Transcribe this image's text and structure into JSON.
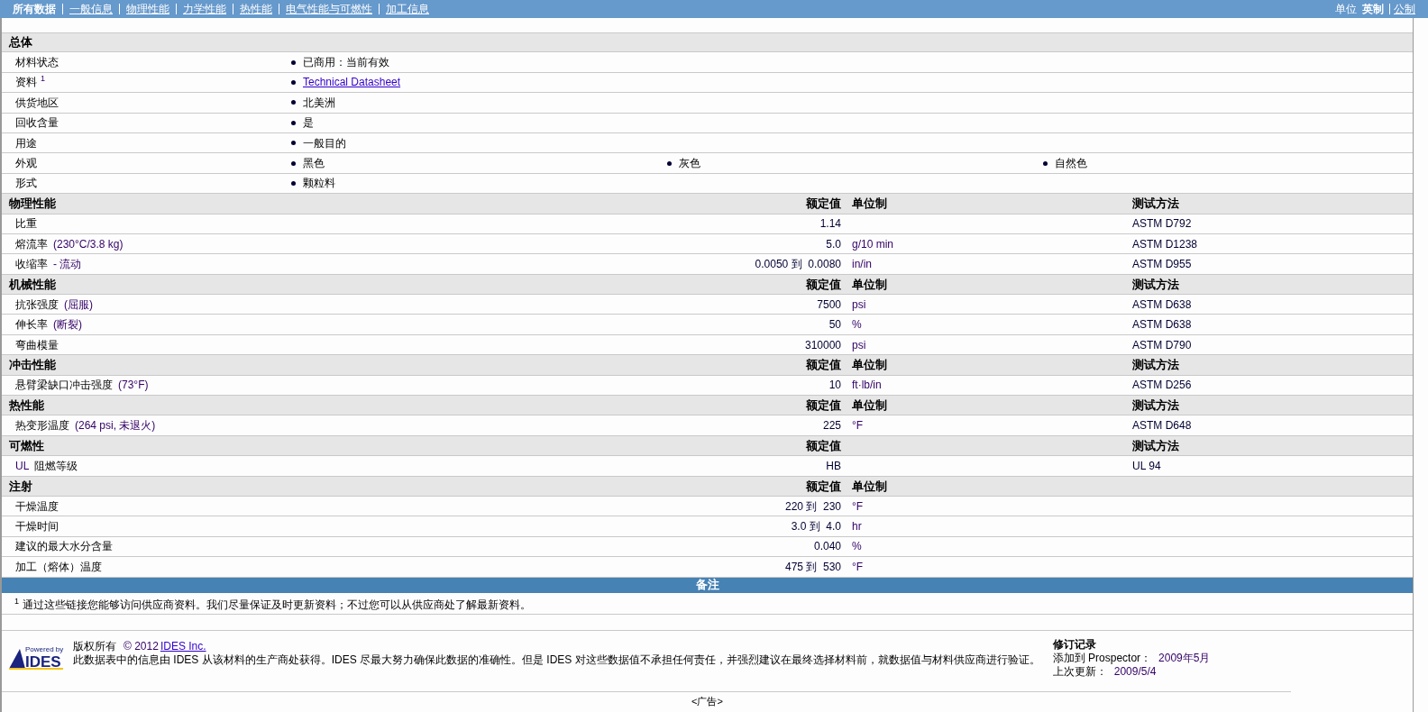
{
  "nav": {
    "tabs": [
      {
        "label": "所有数据",
        "selected": true
      },
      {
        "label": "一般信息",
        "selected": false
      },
      {
        "label": "物理性能",
        "selected": false
      },
      {
        "label": "力学性能",
        "selected": false
      },
      {
        "label": "热性能",
        "selected": false
      },
      {
        "label": "电气性能与可燃性",
        "selected": false
      },
      {
        "label": "加工信息",
        "selected": false
      }
    ],
    "units_label": "单位",
    "units": [
      {
        "label": "英制",
        "selected": true
      },
      {
        "label": "公制",
        "selected": false
      }
    ]
  },
  "sections": [
    {
      "kind": "general",
      "title": "总体",
      "rows": [
        {
          "label": "材料状态",
          "values": [
            {
              "kind": "text",
              "text": "已商用：当前有效"
            }
          ]
        },
        {
          "label": "资料",
          "sup": "1",
          "values": [
            {
              "kind": "link",
              "text": "Technical Datasheet"
            }
          ]
        },
        {
          "label": "供货地区",
          "values": [
            {
              "kind": "text",
              "text": "北美洲"
            }
          ]
        },
        {
          "label": "回收含量",
          "values": [
            {
              "kind": "text",
              "text": "是"
            }
          ]
        },
        {
          "label": "用途",
          "values": [
            {
              "kind": "text",
              "text": "一般目的"
            }
          ]
        },
        {
          "label": "外观",
          "values": [
            {
              "kind": "text",
              "text": "黑色"
            },
            {
              "kind": "text",
              "text": "灰色"
            },
            {
              "kind": "text",
              "text": "自然色"
            }
          ]
        },
        {
          "label": "形式",
          "values": [
            {
              "kind": "text",
              "text": "颗粒料"
            }
          ]
        }
      ]
    },
    {
      "kind": "property",
      "title": "物理性能",
      "headers": {
        "value": "额定值",
        "unit": "单位制",
        "method": "测试方法"
      },
      "rows": [
        {
          "label": "比重",
          "value": "1.14",
          "method": "ASTM D792"
        },
        {
          "label": "熔流率",
          "condition": "(230°C/3.8 kg)",
          "value": "5.0",
          "unit": "g/10 min",
          "method": "ASTM D1238"
        },
        {
          "label": "收缩率",
          "condition": "- 流动",
          "value": "0.0050 到  0.0080",
          "unit": "in/in",
          "method": "ASTM D955"
        }
      ]
    },
    {
      "kind": "property",
      "title": "机械性能",
      "headers": {
        "value": "额定值",
        "unit": "单位制",
        "method": "测试方法"
      },
      "rows": [
        {
          "label": "抗张强度",
          "condition": "(屈服)",
          "value": "7500",
          "unit": "psi",
          "method": "ASTM D638"
        },
        {
          "label": "伸长率",
          "condition": "(断裂)",
          "value": "50",
          "unit": "%",
          "method": "ASTM D638"
        },
        {
          "label": "弯曲模量",
          "value": "310000",
          "unit": "psi",
          "method": "ASTM D790"
        }
      ]
    },
    {
      "kind": "property",
      "title": "冲击性能",
      "headers": {
        "value": "额定值",
        "unit": "单位制",
        "method": "测试方法"
      },
      "rows": [
        {
          "label": "悬臂梁缺口冲击强度",
          "condition": "(73°F)",
          "value": "10",
          "unit": "ft·lb/in",
          "method": "ASTM D256"
        }
      ]
    },
    {
      "kind": "property",
      "title": "热性能",
      "headers": {
        "value": "额定值",
        "unit": "单位制",
        "method": "测试方法"
      },
      "rows": [
        {
          "label": "热变形温度",
          "condition": "(264 psi, 未退火)",
          "value": "225",
          "unit": "°F",
          "method": "ASTM D648"
        }
      ]
    },
    {
      "kind": "property",
      "title": "可燃性",
      "headers": {
        "value": "额定值",
        "method": "测试方法"
      },
      "rows": [
        {
          "prefix": "UL",
          "label": "阻燃等级",
          "value": "HB",
          "method": "UL 94"
        }
      ]
    },
    {
      "kind": "property",
      "title": "注射",
      "headers": {
        "value": "额定值",
        "unit": "单位制"
      },
      "rows": [
        {
          "label": "干燥温度",
          "value": "220 到  230",
          "unit": "°F"
        },
        {
          "label": "干燥时间",
          "value": "3.0 到  4.0",
          "unit": "hr"
        },
        {
          "label": "建议的最大水分含量",
          "value": "0.040",
          "unit": "%"
        },
        {
          "label": "加工（熔体）温度",
          "value": "475 到  530",
          "unit": "°F"
        }
      ]
    }
  ],
  "notes": {
    "title": "备注",
    "items": [
      {
        "sup": "1",
        "text": "通过这些链接您能够访问供应商资料。我们尽量保证及时更新资料；不过您可以从供应商处了解最新资料。"
      }
    ]
  },
  "footer": {
    "logo": {
      "top": "Powered by",
      "brand": "IDES"
    },
    "copyright": {
      "label": "版权所有",
      "year": "© 2012",
      "link": "IDES Inc."
    },
    "disclaimer": "此数据表中的信息由 IDES 从该材料的生产商处获得。IDES 尽最大努力确保此数据的准确性。但是 IDES 对这些数据值不承担任何责任，并强烈建议在最终选择材料前，就数据值与材料供应商进行验证。",
    "revision": {
      "title": "修订记录",
      "items": [
        {
          "label": "添加到 Prospector：",
          "value": "2009年5月"
        },
        {
          "label": "上次更新：",
          "value": "2009/5/4"
        }
      ]
    }
  },
  "ad": "<广告>"
}
